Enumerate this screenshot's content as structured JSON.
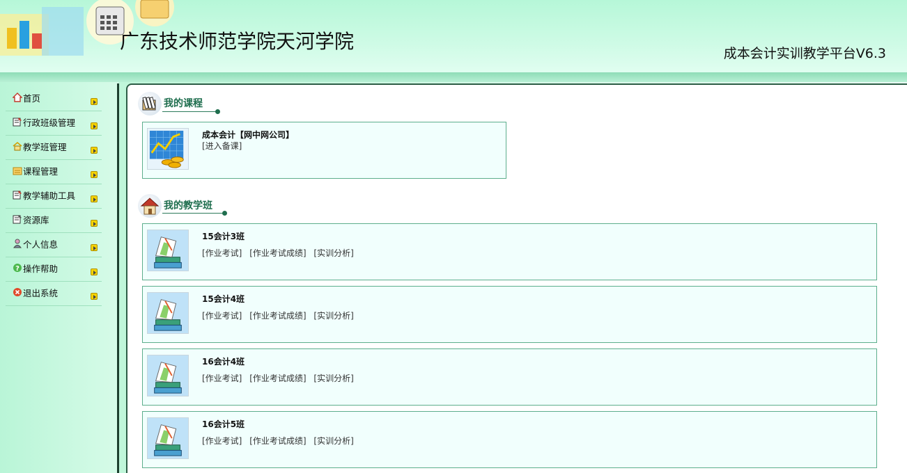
{
  "header": {
    "school_name": "广东技术师范学院天河学院",
    "platform_name": "成本会计实训教学平台V6.3"
  },
  "sidebar": {
    "items": [
      {
        "label": "首页",
        "icon": "home-icon"
      },
      {
        "label": "行政班级管理",
        "icon": "document-edit-icon"
      },
      {
        "label": "教学班管理",
        "icon": "class-house-icon"
      },
      {
        "label": "课程管理",
        "icon": "folder-icon"
      },
      {
        "label": "教学辅助工具",
        "icon": "document-edit-icon"
      },
      {
        "label": "资源库",
        "icon": "document-edit-icon"
      },
      {
        "label": "个人信息",
        "icon": "user-icon"
      },
      {
        "label": "操作帮助",
        "icon": "help-icon"
      },
      {
        "label": "退出系统",
        "icon": "exit-icon"
      }
    ]
  },
  "courses_section": {
    "title": "我的课程",
    "icon": "book-box-icon",
    "courses": [
      {
        "name": "成本会计【网中网公司】",
        "action": "[进入备课]",
        "icon": "chart-coins-icon"
      }
    ]
  },
  "classes_section": {
    "title": "我的教学班",
    "icon": "house-icon",
    "classes": [
      {
        "name": "15会计3班",
        "links": [
          "[作业考试]",
          "[作业考试成绩]",
          "[实训分析]"
        ]
      },
      {
        "name": "15会计4班",
        "links": [
          "[作业考试]",
          "[作业考试成绩]",
          "[实训分析]"
        ]
      },
      {
        "name": "16会计4班",
        "links": [
          "[作业考试]",
          "[作业考试成绩]",
          "[实训分析]"
        ]
      },
      {
        "name": "16会计5班",
        "links": [
          "[作业考试]",
          "[作业考试成绩]",
          "[实训分析]"
        ]
      }
    ]
  },
  "colors": {
    "accent_green": "#1f6e4e",
    "card_border": "#5cae8c",
    "card_bg": "#f1fffd"
  }
}
